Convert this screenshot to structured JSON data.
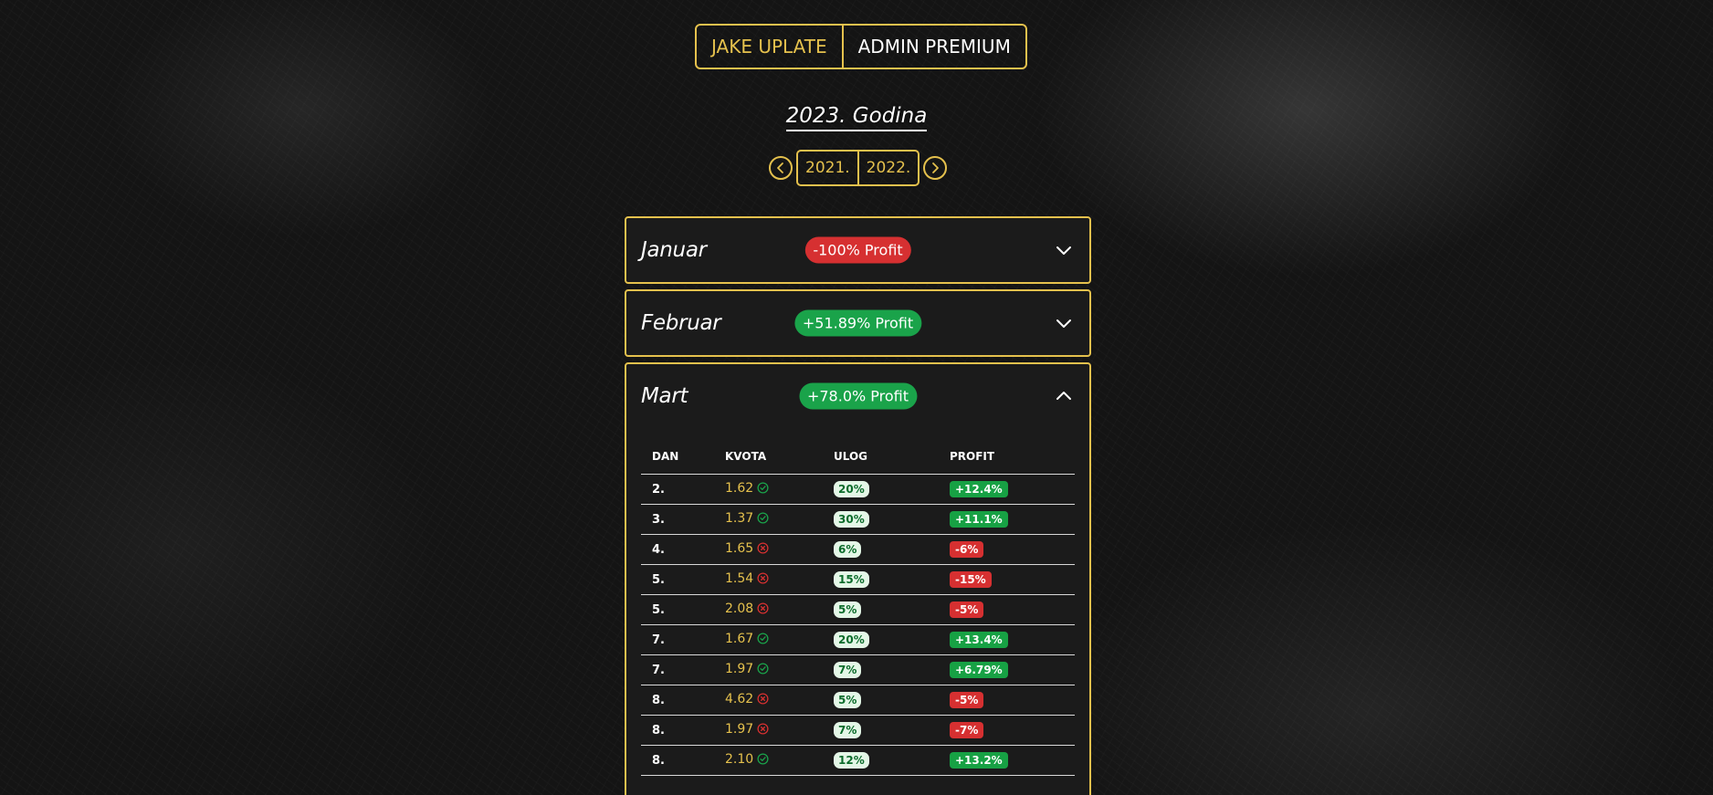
{
  "tabs": [
    {
      "label": "JAKE UPLATE",
      "active": true
    },
    {
      "label": "ADMIN PREMIUM",
      "active": false
    }
  ],
  "year_title": "2023. Godina",
  "year_nav": {
    "prev_icon": "chevron-left-icon",
    "next_icon": "chevron-right-icon",
    "years": [
      "2021.",
      "2022."
    ]
  },
  "months": [
    {
      "name": "Januar",
      "profit": "-100% Profit",
      "status": "negative",
      "expanded": false
    },
    {
      "name": "Februar",
      "profit": "+51.89% Profit",
      "status": "positive",
      "expanded": false
    },
    {
      "name": "Mart",
      "profit": "+78.0% Profit",
      "status": "positive",
      "expanded": true
    }
  ],
  "table": {
    "headers": [
      "DAN",
      "KVOTA",
      "ULOG",
      "PROFIT"
    ],
    "rows": [
      {
        "dan": "2.",
        "kvota": "1.62",
        "won": true,
        "ulog": "20%",
        "profit": "+12.4%"
      },
      {
        "dan": "3.",
        "kvota": "1.37",
        "won": true,
        "ulog": "30%",
        "profit": "+11.1%"
      },
      {
        "dan": "4.",
        "kvota": "1.65",
        "won": false,
        "ulog": "6%",
        "profit": "-6%"
      },
      {
        "dan": "5.",
        "kvota": "1.54",
        "won": false,
        "ulog": "15%",
        "profit": "-15%"
      },
      {
        "dan": "5.",
        "kvota": "2.08",
        "won": false,
        "ulog": "5%",
        "profit": "-5%"
      },
      {
        "dan": "7.",
        "kvota": "1.67",
        "won": true,
        "ulog": "20%",
        "profit": "+13.4%"
      },
      {
        "dan": "7.",
        "kvota": "1.97",
        "won": true,
        "ulog": "7%",
        "profit": "+6.79%"
      },
      {
        "dan": "8.",
        "kvota": "4.62",
        "won": false,
        "ulog": "5%",
        "profit": "-5%"
      },
      {
        "dan": "8.",
        "kvota": "1.97",
        "won": false,
        "ulog": "7%",
        "profit": "-7%"
      },
      {
        "dan": "8.",
        "kvota": "2.10",
        "won": true,
        "ulog": "12%",
        "profit": "+13.2%"
      }
    ]
  },
  "colors": {
    "accent": "#e5c14d",
    "positive": "#1aa34a",
    "negative": "#d63031"
  }
}
